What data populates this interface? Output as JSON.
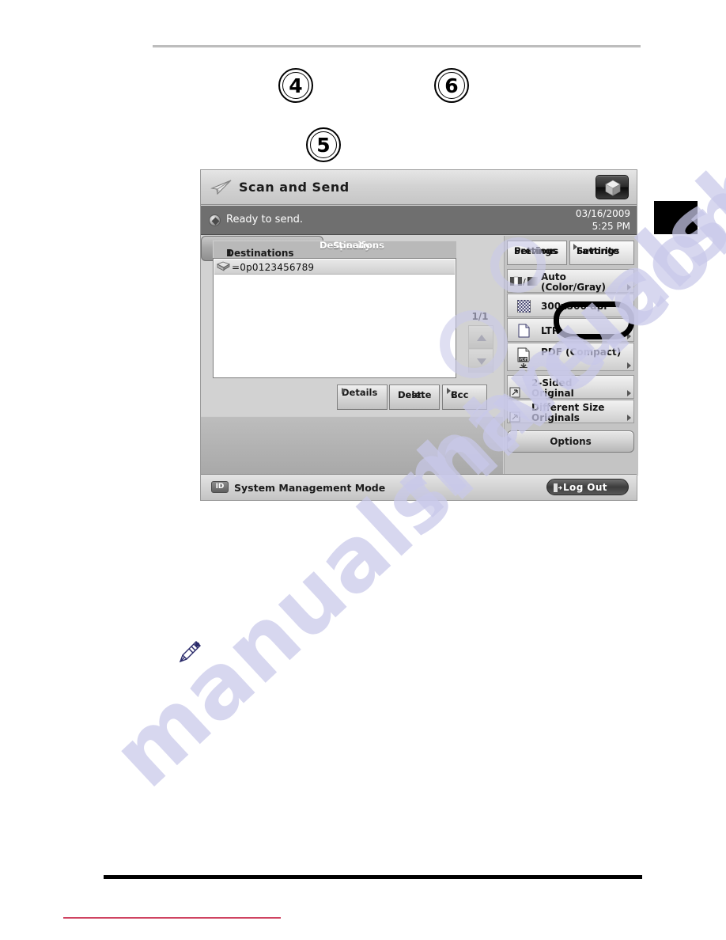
{
  "page": {
    "step_callouts": [
      {
        "number": "4",
        "name": "step-callout-4"
      },
      {
        "number": "5",
        "name": "step-callout-5"
      },
      {
        "number": "6",
        "name": "step-callout-6"
      }
    ],
    "note_icon": "pencil-note-icon",
    "watermark": "manualshive.com",
    "tab_marker": "chapter-tab-marker"
  },
  "device_panel": {
    "titlebar": {
      "icon": "paper-plane-icon",
      "title": "Scan and Send",
      "cube_button_icon": "cube-icon"
    },
    "statusbar": {
      "led_icon": "status-indicator-icon",
      "message": "Ready to send.",
      "date": "03/16/2009",
      "time": "5:25 PM"
    },
    "destinations": {
      "header_label": "Destinations",
      "header_separator": ":",
      "count": "1",
      "rows": [
        {
          "icon": "address-book-icon",
          "text": "=0p0123456789"
        }
      ],
      "page_indicator": "1/1",
      "scroll_up_icon": "triangle-up-icon",
      "scroll_down_icon": "triangle-down-icon"
    },
    "left_buttons": {
      "specify": {
        "line1": "Specify",
        "line2": "Destinations"
      },
      "details": {
        "line1": "Details",
        "line2": ""
      },
      "delete": {
        "line1": "Delete",
        "line2": "Dest."
      },
      "ccbcc": {
        "line1": "Cc",
        "line2": "Bcc"
      }
    },
    "right_panel": {
      "previous_settings": {
        "line1": "Previous",
        "line2": "Settings"
      },
      "favorite_settings": {
        "line1": "Favorite",
        "line2": "Settings",
        "highlighted": true
      },
      "settings_rows": [
        {
          "icon": "color-mode-icon",
          "line1": "Auto",
          "line2": "(Color/Gray)",
          "name": "setting-color-mode"
        },
        {
          "icon": "resolution-icon",
          "line1": "300x300 dpi",
          "line2": "",
          "name": "setting-resolution"
        },
        {
          "icon": "paper-size-icon",
          "line1": "LTR",
          "line2": "",
          "name": "setting-paper-size"
        },
        {
          "icon": "pdf-file-icon",
          "line1": "PDF (Compact)",
          "line2": "",
          "name": "setting-file-format"
        },
        {
          "icon": "two-sided-icon",
          "line1": "2-Sided",
          "line2": "Original",
          "name": "setting-two-sided-original"
        },
        {
          "icon": "different-size-icon",
          "line1": "Different Size",
          "line2": "Originals",
          "name": "setting-different-size-originals"
        }
      ],
      "options_button": "Options"
    },
    "footer": {
      "id_badge": "ID",
      "mode_label": "System Management Mode",
      "logout_button": "Log Out",
      "logout_icon": "logout-icon"
    }
  },
  "colors": {
    "panel_background": "#d2d2d2",
    "statusbar": "#6f6f6f",
    "highlight_outline": "#000000",
    "watermark": "#c9c9ea",
    "footer_red_rule": "#cf4361"
  }
}
